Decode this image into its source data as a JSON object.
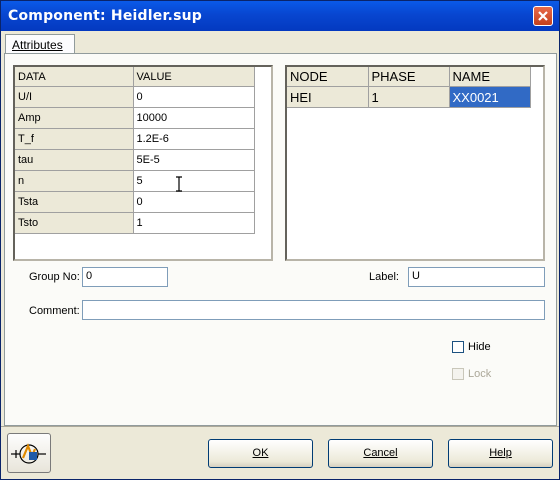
{
  "window": {
    "title": "Component: Heidler.sup"
  },
  "tabs": [
    {
      "label": "Attributes"
    }
  ],
  "data_grid": {
    "headers": [
      "DATA",
      "VALUE"
    ],
    "rows": [
      {
        "key": "U/I",
        "value": "0"
      },
      {
        "key": "Amp",
        "value": "10000"
      },
      {
        "key": "T_f",
        "value": "1.2E-6"
      },
      {
        "key": "tau",
        "value": "5E-5"
      },
      {
        "key": "n",
        "value": "5"
      },
      {
        "key": "Tsta",
        "value": "0"
      },
      {
        "key": "Tsto",
        "value": "1"
      }
    ]
  },
  "node_grid": {
    "headers": [
      "NODE",
      "PHASE",
      "NAME"
    ],
    "rows": [
      {
        "node": "HEI",
        "phase": "1",
        "name": "XX0021"
      }
    ]
  },
  "group": {
    "label": "Group No:",
    "value": "0"
  },
  "label_field": {
    "label": "Label:",
    "value": "U"
  },
  "comment": {
    "label": "Comment:",
    "value": ""
  },
  "hide": {
    "label": "Hide",
    "checked": false
  },
  "lock": {
    "label": "Lock",
    "checked": false,
    "disabled": true
  },
  "buttons": {
    "ok": "OK",
    "cancel": "Cancel",
    "help": "Help"
  },
  "icons": {
    "component": "component-symbol-icon",
    "close": "close-icon",
    "cursor": "text-cursor-icon"
  }
}
